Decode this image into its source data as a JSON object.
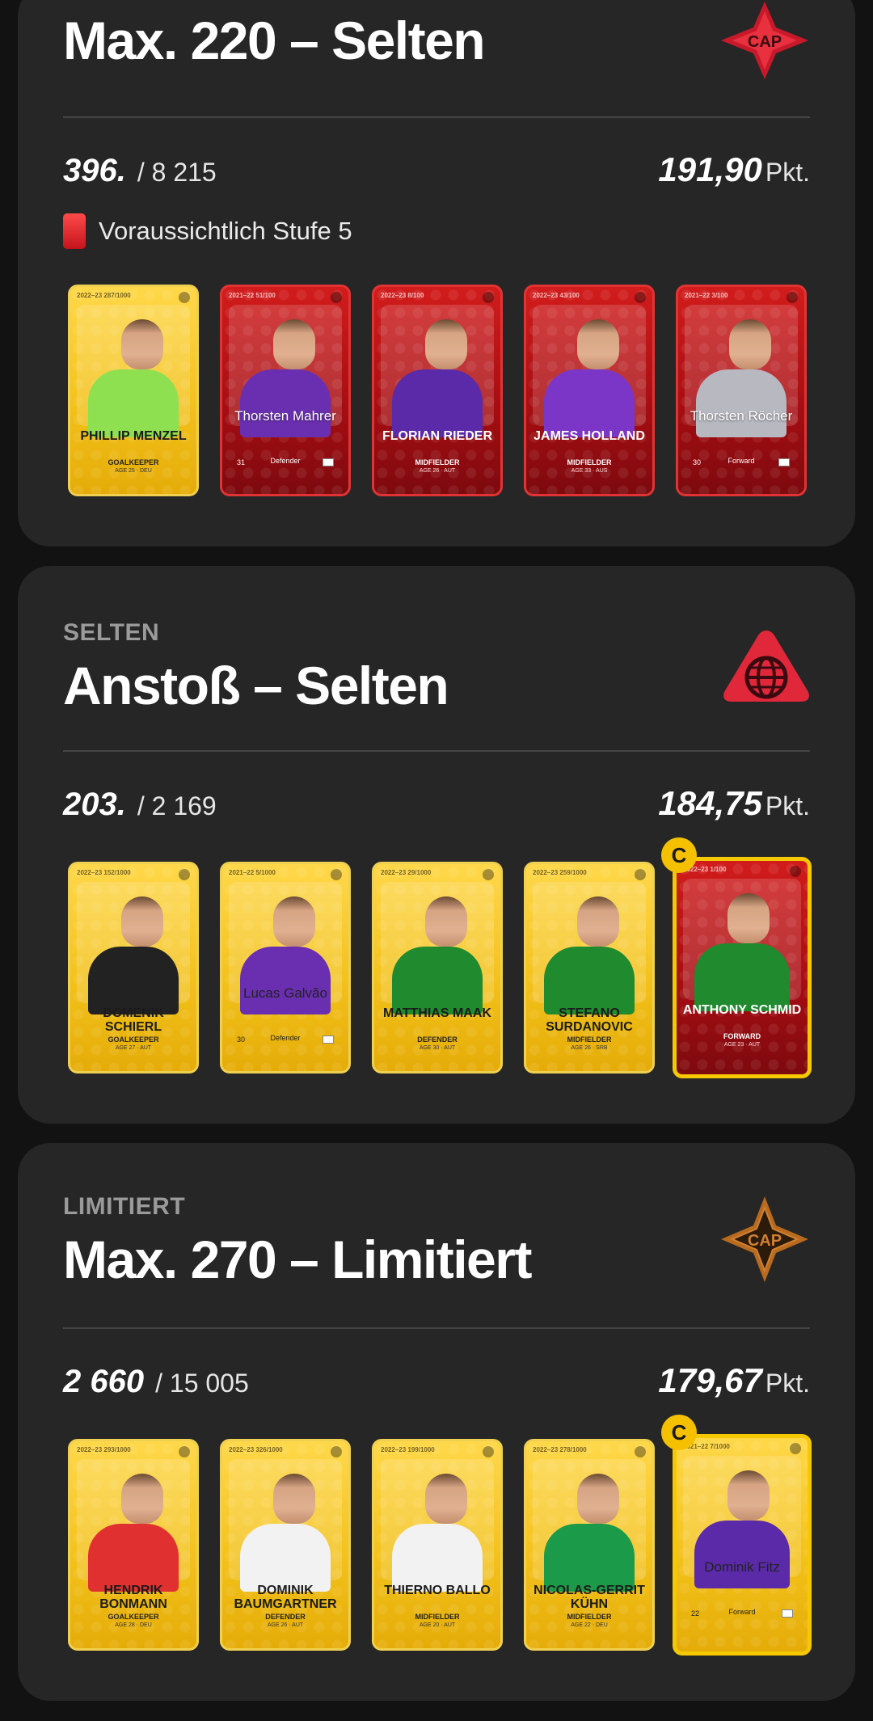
{
  "sections": [
    {
      "kicker": "",
      "title": "Max. 220 – Selten",
      "badge": "CAP",
      "rank": "396.",
      "total": "/ 8 215",
      "points": "191,90",
      "pts_unit": "Pkt.",
      "level": "Voraussichtlich Stufe 5",
      "cards": [
        {
          "name": "PHILLIP MENZEL",
          "position": "GOALKEEPER",
          "age": "AGE 25 · DEU",
          "season": "2022–23 287/1000",
          "rarity": "limited",
          "style": "portrait",
          "jersey": "#8fe050"
        },
        {
          "name": "Thorsten Mahrer",
          "position": "Defender",
          "age": "31",
          "season": "2021–22 51/100",
          "rarity": "rare",
          "style": "plain",
          "jersey": "#6a2fb0"
        },
        {
          "name": "FLORIAN RIEDER",
          "position": "MIDFIELDER",
          "age": "AGE 26 · AUT",
          "season": "2022–23 8/100",
          "rarity": "rare",
          "style": "portrait",
          "jersey": "#5a2aa8"
        },
        {
          "name": "JAMES HOLLAND",
          "position": "MIDFIELDER",
          "age": "AGE 33 · AUS",
          "season": "2022–23 43/100",
          "rarity": "rare",
          "style": "portrait",
          "jersey": "#7b36c8"
        },
        {
          "name": "Thorsten Röcher",
          "position": "Forward",
          "age": "30",
          "season": "2021–22 3/100",
          "rarity": "rare",
          "style": "plain",
          "jersey": "#b8b8c0"
        }
      ]
    },
    {
      "kicker": "SELTEN",
      "title": "Anstoß – Selten",
      "badge": "globe",
      "rank": "203.",
      "total": "/ 2 169",
      "points": "184,75",
      "pts_unit": "Pkt.",
      "level": "",
      "cards": [
        {
          "name": "DOMENIK SCHIERL",
          "position": "GOALKEEPER",
          "age": "AGE 27 · AUT",
          "season": "2022–23 152/1000",
          "rarity": "limited",
          "style": "portrait",
          "jersey": "#222222"
        },
        {
          "name": "Lucas Galvão",
          "position": "Defender",
          "age": "30",
          "season": "2021–22 5/1000",
          "rarity": "limited",
          "style": "plain",
          "jersey": "#6a2fb0"
        },
        {
          "name": "MATTHIAS MAAK",
          "position": "DEFENDER",
          "age": "AGE 30 · AUT",
          "season": "2022–23 29/1000",
          "rarity": "limited",
          "style": "portrait",
          "jersey": "#1f8a2e"
        },
        {
          "name": "STEFANO SURDANOVIC",
          "position": "MIDFIELDER",
          "age": "AGE 26 · SRB",
          "season": "2022–23 259/1000",
          "rarity": "limited",
          "style": "portrait",
          "jersey": "#1f8a2e"
        },
        {
          "name": "ANTHONY SCHMID",
          "position": "FORWARD",
          "age": "AGE 23 · AUT",
          "season": "2022–23 1/100",
          "rarity": "rare",
          "style": "portrait",
          "jersey": "#1f8a2e",
          "captain": true
        }
      ],
      "captain_label": "C"
    },
    {
      "kicker": "LIMITIERT",
      "title": "Max. 270 – Limitiert",
      "badge": "CAP",
      "rank": "2 660",
      "total": "/ 15 005",
      "points": "179,67",
      "pts_unit": "Pkt.",
      "level": "",
      "cards": [
        {
          "name": "HENDRIK BONMANN",
          "position": "GOALKEEPER",
          "age": "AGE 28 · DEU",
          "season": "2022–23 293/1000",
          "rarity": "limited",
          "style": "portrait",
          "jersey": "#e03030"
        },
        {
          "name": "DOMINIK BAUMGARTNER",
          "position": "DEFENDER",
          "age": "AGE 26 · AUT",
          "season": "2022–23 326/1000",
          "rarity": "limited",
          "style": "portrait",
          "jersey": "#f2f2f2"
        },
        {
          "name": "THIERNO BALLO",
          "position": "MIDFIELDER",
          "age": "AGE 20 · AUT",
          "season": "2022–23 199/1000",
          "rarity": "limited",
          "style": "portrait",
          "jersey": "#f2f2f2"
        },
        {
          "name": "NICOLAS-GERRIT KÜHN",
          "position": "MIDFIELDER",
          "age": "AGE 22 · DEU",
          "season": "2022–23 278/1000",
          "rarity": "limited",
          "style": "portrait",
          "jersey": "#1b9a4a"
        },
        {
          "name": "Dominik Fitz",
          "position": "Forward",
          "age": "22",
          "season": "2021–22 7/1000",
          "rarity": "limited",
          "style": "plain",
          "jersey": "#5a2aa8",
          "captain": true
        }
      ],
      "captain_label": "C"
    }
  ]
}
